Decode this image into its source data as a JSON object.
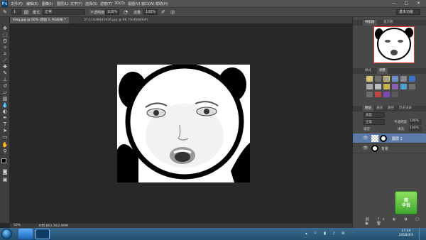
{
  "app": {
    "logo": "Ps"
  },
  "menu": [
    "文件(F)",
    "编辑(E)",
    "图像(I)",
    "图层(L)",
    "文字(Y)",
    "选择(S)",
    "滤镜(T)",
    "3D(D)",
    "视图(V)",
    "窗口(W)",
    "帮助(H)"
  ],
  "window_controls": "— ▢ ✕",
  "options": {
    "size_value": "1",
    "mode_label": "模式:",
    "mode_value": "正常",
    "opacity_label": "不透明度:",
    "opacity_value": "100%",
    "flow_label": "流量:",
    "flow_value": "100%",
    "workspace": "基本功能"
  },
  "tabs": [
    {
      "label": "timg.jpg @ 50% (图层 1, RGB/8) *",
      "active": true
    },
    {
      "label": "37-110d9441926.jpg @ 66.7%(RGB/8#)",
      "active": false
    }
  ],
  "status": {
    "zoom": "50%",
    "doc": "文档:863.3K/2.89M"
  },
  "panels": {
    "nav_tabs": [
      "导航器",
      "直方图"
    ],
    "adj_tabs": [
      "样式",
      "调整"
    ],
    "layer_tabs": [
      "图层",
      "通道",
      "路径",
      "历史记录"
    ],
    "kind_label": "类型",
    "blend_mode": "正常",
    "opacity_label": "不透明度:",
    "opacity_value": "100%",
    "lock_label": "锁定:",
    "fill_label": "填充:",
    "fill_value": "100%",
    "layers": [
      {
        "name": "图层 1",
        "selected": true
      },
      {
        "name": "背景",
        "selected": false
      }
    ]
  },
  "badge": {
    "line1": "简",
    "line2": "中说"
  },
  "clock": {
    "time": "17:24",
    "date": "2018/4/3"
  },
  "colors": {
    "accent": "#e33333",
    "canvas_bg": "#282828",
    "panel_bg": "#484848"
  }
}
